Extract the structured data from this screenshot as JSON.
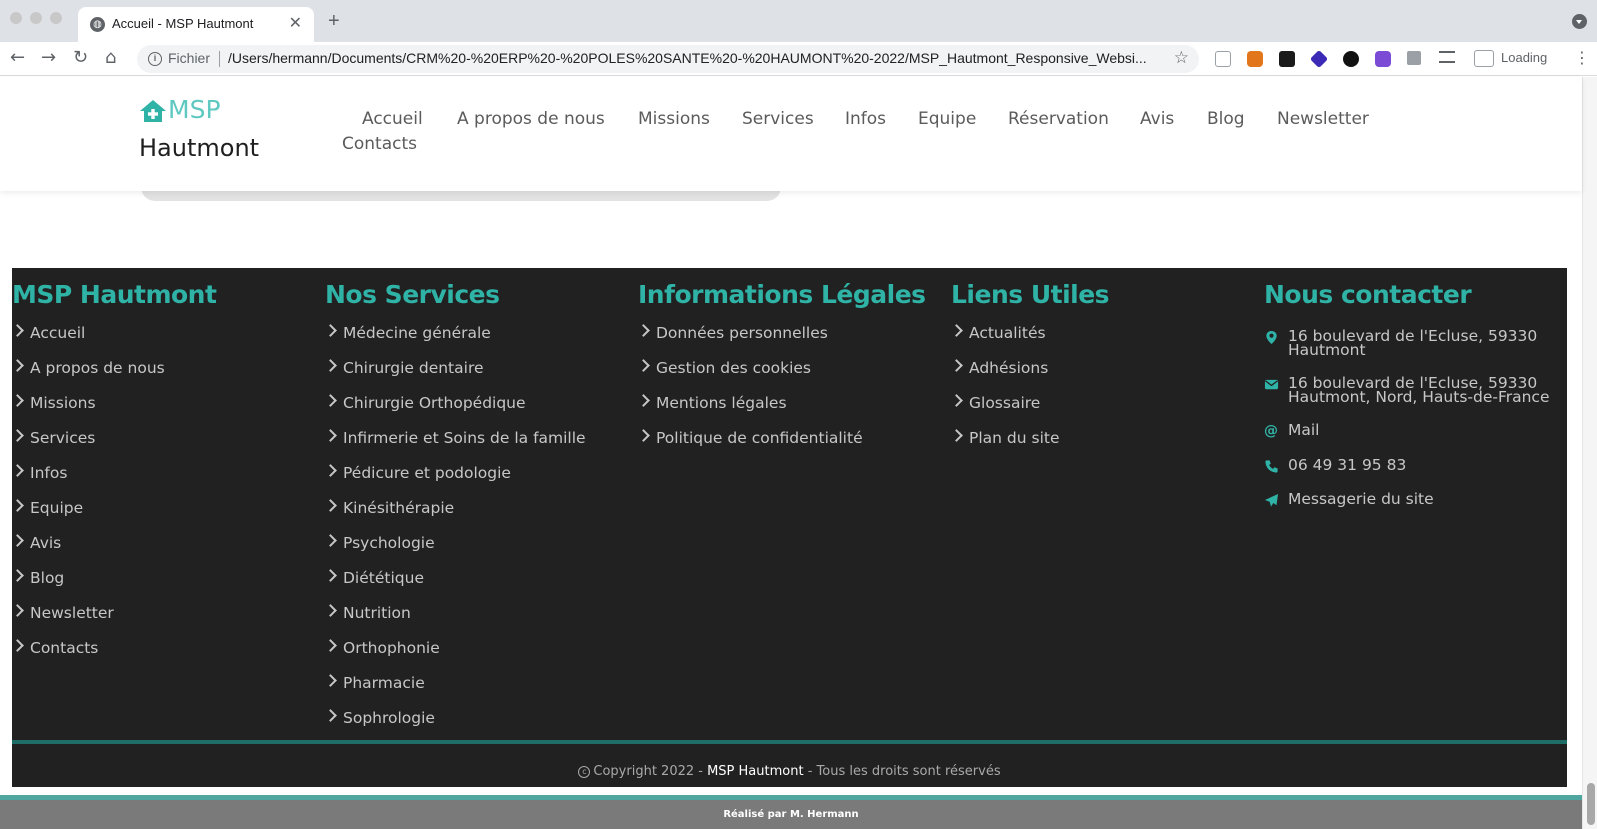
{
  "browser": {
    "tab_title": "Accueil - MSP Hautmont",
    "url_scheme": "Fichier",
    "url": "/Users/hermann/Documents/CRM%20-%20ERP%20-%20POLES%20SANTE%20-%20HAUMONT%20-2022/MSP_Hautmont_Responsive_Websi...",
    "loading_label": "Loading",
    "new_tab_symbol": "+",
    "close_symbol": "✕",
    "star_symbol": "☆",
    "back_symbol": "←",
    "forward_symbol": "→",
    "reload_symbol": "↻",
    "home_symbol": "⌂",
    "menu_symbol": "⋮",
    "info_symbol": "i"
  },
  "site": {
    "logo_msp": "MSP",
    "logo_town": "Hautmont",
    "accent_color": "#2fb3a6",
    "nav": [
      "Accueil",
      "A propos de nous",
      "Missions",
      "Services",
      "Infos",
      "Equipe",
      "Réservation",
      "Avis",
      "Blog",
      "Newsletter",
      "Contacts"
    ]
  },
  "footer": {
    "col1": {
      "title": "MSP Hautmont",
      "links": [
        "Accueil",
        "A propos de nous",
        "Missions",
        "Services",
        "Infos",
        "Equipe",
        "Avis",
        "Blog",
        "Newsletter",
        "Contacts"
      ]
    },
    "col2": {
      "title": "Nos Services",
      "links": [
        "Médecine générale",
        "Chirurgie dentaire",
        "Chirurgie Orthopédique",
        "Infirmerie et Soins de la famille",
        "Pédicure et podologie",
        "Kinésithérapie",
        "Psychologie",
        "Diététique",
        "Nutrition",
        "Orthophonie",
        "Pharmacie",
        "Sophrologie"
      ]
    },
    "col3": {
      "title": "Informations Légales",
      "links": [
        "Données personnelles",
        "Gestion des cookies",
        "Mentions légales",
        "Politique de confidentialité"
      ]
    },
    "col4": {
      "title": "Liens Utiles",
      "links": [
        "Actualités",
        "Adhésions",
        "Glossaire",
        "Plan du site"
      ]
    },
    "col5": {
      "title": "Nous contacter",
      "address": "16 boulevard de l'Ecluse, 59330 Hautmont",
      "postal": "16 boulevard de l'Ecluse, 59330 Hautmont, Nord, Hauts-de-France",
      "mail": "Mail",
      "phone": "06 49 31 95 83",
      "messaging": "Messagerie du site"
    },
    "copyright_prefix": "Copyright 2022 -",
    "copyright_brand": "MSP Hautmont",
    "copyright_suffix": "- Tous les droits sont réservés",
    "copyright_symbol": "c",
    "credit": "Réalisé par M. Hermann"
  }
}
